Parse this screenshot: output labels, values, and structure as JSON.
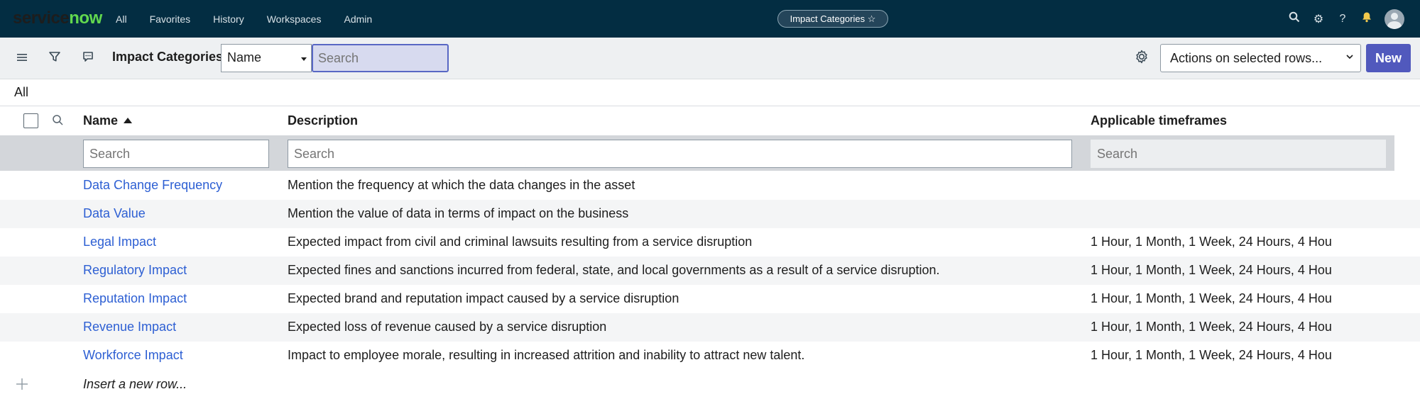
{
  "topbar": {
    "logo_service": "service",
    "logo_now": "now",
    "nav": [
      "All",
      "Favorites",
      "History",
      "Workspaces",
      "Admin"
    ],
    "context_pill": "Impact Categories ☆"
  },
  "toolbar": {
    "title": "Impact Categories",
    "field_select_value": "Name",
    "search_placeholder": "Search",
    "actions_select_value": "Actions on selected rows...",
    "new_label": "New"
  },
  "breadcrumb": "All",
  "columns": {
    "name": "Name",
    "description": "Description",
    "timeframes": "Applicable timeframes"
  },
  "filters": {
    "name_placeholder": "Search",
    "description_placeholder": "Search",
    "timeframes_placeholder": "Search"
  },
  "rows": [
    {
      "name": "Data Change Frequency",
      "description": "Mention the frequency at which the data changes in the asset",
      "timeframes": ""
    },
    {
      "name": "Data Value",
      "description": "Mention the value of data in terms of impact on the business",
      "timeframes": ""
    },
    {
      "name": "Legal Impact",
      "description": "Expected impact from civil and criminal lawsuits resulting from a service disruption",
      "timeframes": "1 Hour, 1 Month, 1 Week, 24 Hours, 4 Hou"
    },
    {
      "name": "Regulatory Impact",
      "description": "Expected fines and sanctions incurred from federal, state, and local governments as a result of a service disruption.",
      "timeframes": "1 Hour, 1 Month, 1 Week, 24 Hours, 4 Hou"
    },
    {
      "name": "Reputation Impact",
      "description": "Expected brand and reputation impact caused by a service disruption",
      "timeframes": "1 Hour, 1 Month, 1 Week, 24 Hours, 4 Hou"
    },
    {
      "name": "Revenue Impact",
      "description": "Expected loss of revenue caused by a service disruption",
      "timeframes": "1 Hour, 1 Month, 1 Week, 24 Hours, 4 Hou"
    },
    {
      "name": "Workforce Impact",
      "description": "Impact to employee morale, resulting in increased attrition and inability to attract new talent.",
      "timeframes": "1 Hour, 1 Month, 1 Week, 24 Hours, 4 Hou"
    }
  ],
  "insert_row_label": "Insert a new row...",
  "colors": {
    "topbar_bg": "#032d42",
    "link": "#2d5fd3",
    "primary_button": "#5159bd",
    "logo_accent": "#62d84e"
  }
}
